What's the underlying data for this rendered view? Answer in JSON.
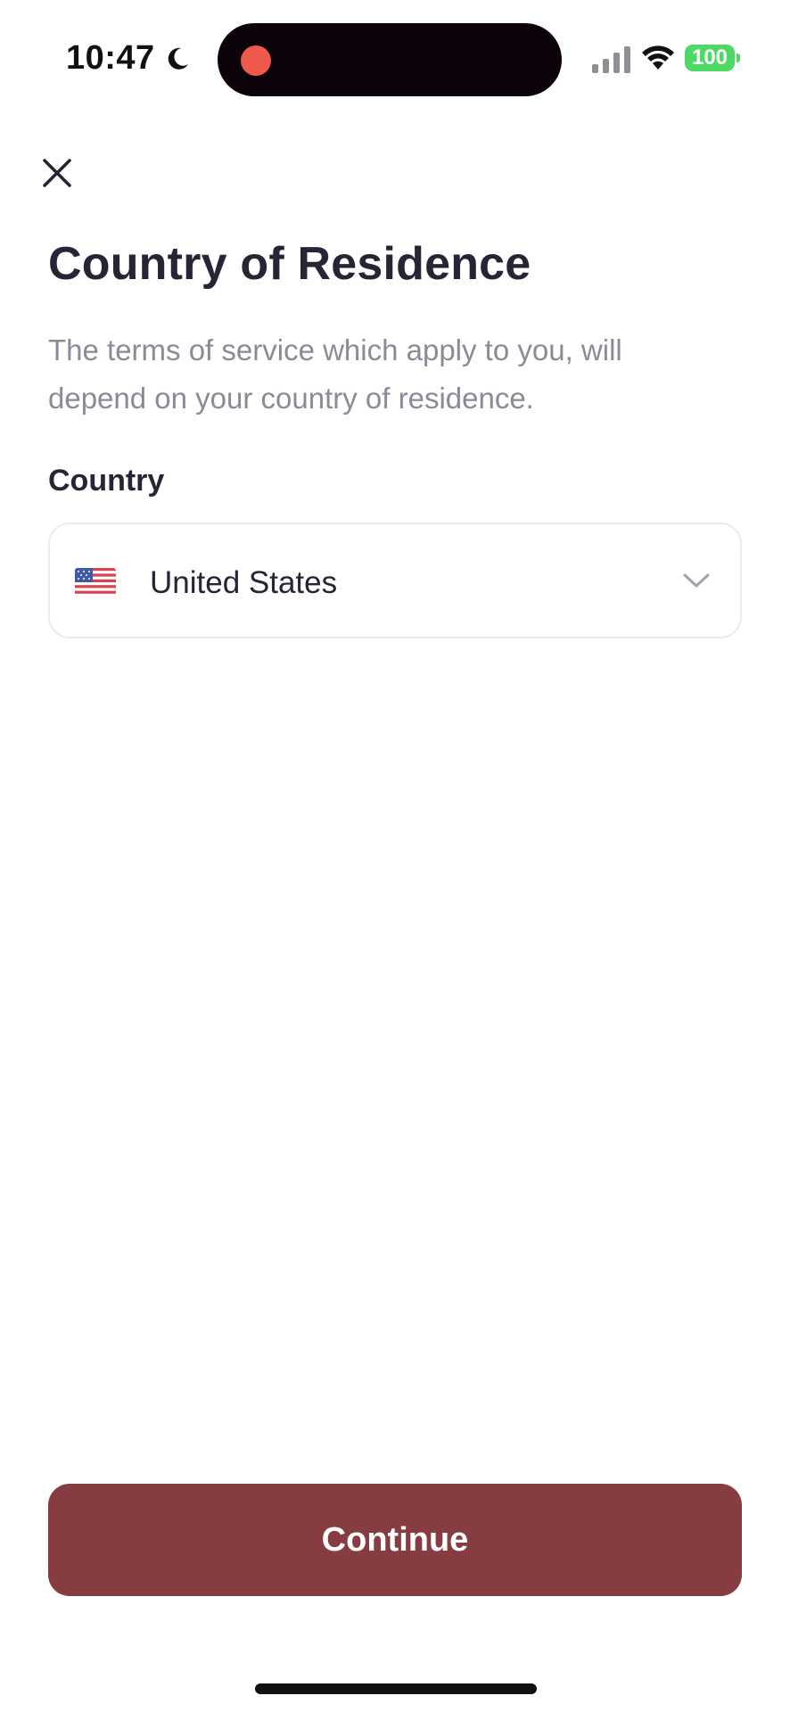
{
  "status_bar": {
    "time": "10:47",
    "battery_level": "100",
    "icons": [
      "moon-icon",
      "cellular-icon",
      "wifi-icon",
      "battery-icon"
    ],
    "recording_indicator_color": "#ee5a4a",
    "battery_color": "#4cd964"
  },
  "header": {
    "close_icon": "close-icon"
  },
  "main": {
    "title": "Country of Residence",
    "description": "The terms of service which apply to you, will depend on your country of residence.",
    "country_field": {
      "label": "Country",
      "value": "United States",
      "flag_icon": "us-flag-icon",
      "dropdown_icon": "chevron-down-icon"
    }
  },
  "footer": {
    "continue_label": "Continue",
    "button_color": "#863c41"
  }
}
